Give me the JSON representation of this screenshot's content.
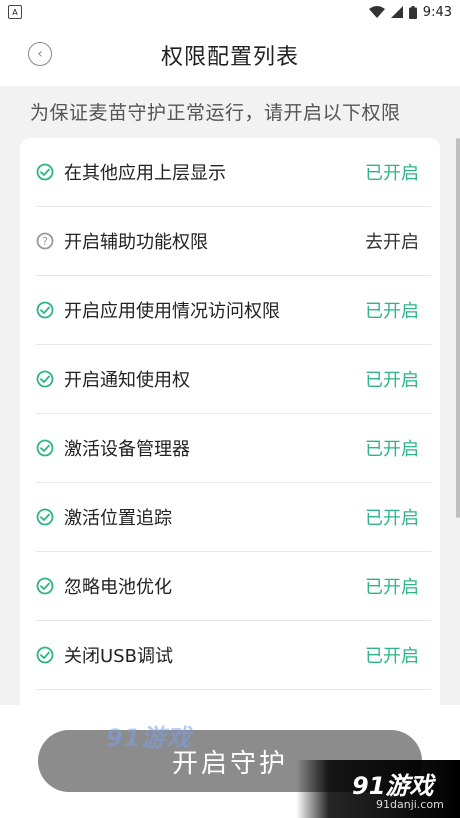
{
  "status_bar": {
    "time": "9:43",
    "notification_icon": "A"
  },
  "header": {
    "title": "权限配置列表",
    "back_icon": "chevron-left-icon"
  },
  "notice": "为保证麦苗守护正常运行，请开启以下权限",
  "colors": {
    "enabled": "#2fb585",
    "button": "#8c8c8c"
  },
  "permissions": [
    {
      "label": "在其他应用上层显示",
      "status": "已开启",
      "icon": "check-circle-icon"
    },
    {
      "label": "开启辅助功能权限",
      "status": "去开启",
      "icon": "question-circle-icon"
    },
    {
      "label": "开启应用使用情况访问权限",
      "status": "已开启",
      "icon": "check-circle-icon"
    },
    {
      "label": "开启通知使用权",
      "status": "已开启",
      "icon": "check-circle-icon"
    },
    {
      "label": "激活设备管理器",
      "status": "已开启",
      "icon": "check-circle-icon"
    },
    {
      "label": "激活位置追踪",
      "status": "已开启",
      "icon": "check-circle-icon"
    },
    {
      "label": "忽略电池优化",
      "status": "已开启",
      "icon": "check-circle-icon"
    },
    {
      "label": "关闭USB调试",
      "status": "已开启",
      "icon": "check-circle-icon"
    }
  ],
  "main_button": "开启守护",
  "watermark": {
    "left": "91游戏",
    "right": "91游戏",
    "right_url": "91danji.com"
  }
}
